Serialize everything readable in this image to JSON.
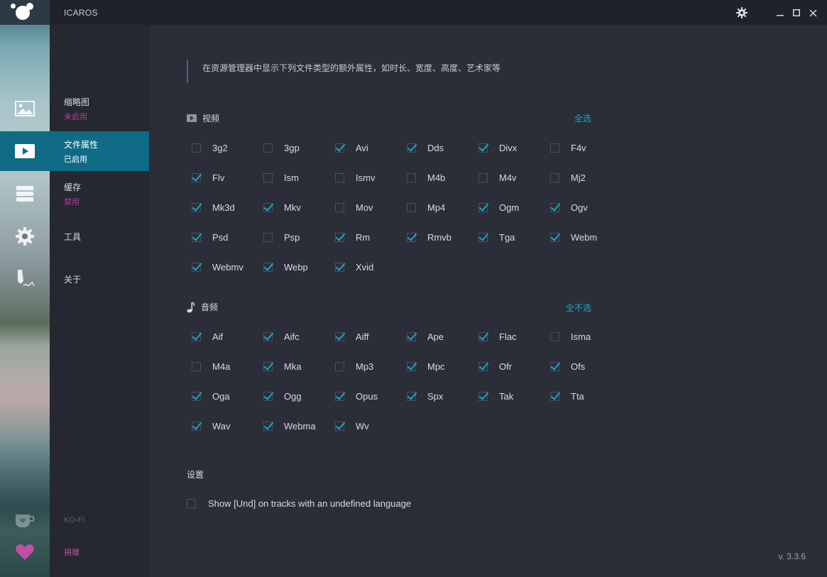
{
  "app": {
    "title": "ICAROS"
  },
  "nav": {
    "items": [
      {
        "label": "缩略图",
        "status": "未启用"
      },
      {
        "label": "文件属性",
        "status": "已启用"
      },
      {
        "label": "缓存",
        "status": "禁用"
      },
      {
        "label": "工具",
        "status": ""
      },
      {
        "label": "关于",
        "status": ""
      }
    ],
    "kofi": "KO-FI",
    "donate": "捐赠"
  },
  "main": {
    "description": "在资源管理器中显示下列文件类型的额外属性，如时长、宽度、高度、艺术家等",
    "video": {
      "heading": "视频",
      "toggle_label": "全选",
      "items": [
        {
          "label": "3g2",
          "checked": false
        },
        {
          "label": "3gp",
          "checked": false
        },
        {
          "label": "Avi",
          "checked": true
        },
        {
          "label": "Dds",
          "checked": true
        },
        {
          "label": "Divx",
          "checked": true
        },
        {
          "label": "F4v",
          "checked": false
        },
        {
          "label": "Flv",
          "checked": true
        },
        {
          "label": "Ism",
          "checked": false
        },
        {
          "label": "Ismv",
          "checked": false
        },
        {
          "label": "M4b",
          "checked": false
        },
        {
          "label": "M4v",
          "checked": false
        },
        {
          "label": "Mj2",
          "checked": false
        },
        {
          "label": "Mk3d",
          "checked": true
        },
        {
          "label": "Mkv",
          "checked": true
        },
        {
          "label": "Mov",
          "checked": false
        },
        {
          "label": "Mp4",
          "checked": false
        },
        {
          "label": "Ogm",
          "checked": true
        },
        {
          "label": "Ogv",
          "checked": true
        },
        {
          "label": "Psd",
          "checked": true
        },
        {
          "label": "Psp",
          "checked": false
        },
        {
          "label": "Rm",
          "checked": true
        },
        {
          "label": "Rmvb",
          "checked": true
        },
        {
          "label": "Tga",
          "checked": true
        },
        {
          "label": "Webm",
          "checked": true
        },
        {
          "label": "Webmv",
          "checked": true
        },
        {
          "label": "Webp",
          "checked": true
        },
        {
          "label": "Xvid",
          "checked": true
        }
      ]
    },
    "audio": {
      "heading": "音频",
      "toggle_label": "全不选",
      "items": [
        {
          "label": "Aif",
          "checked": true
        },
        {
          "label": "Aifc",
          "checked": true
        },
        {
          "label": "Aiff",
          "checked": true
        },
        {
          "label": "Ape",
          "checked": true
        },
        {
          "label": "Flac",
          "checked": true
        },
        {
          "label": "Isma",
          "checked": false
        },
        {
          "label": "M4a",
          "checked": false
        },
        {
          "label": "Mka",
          "checked": true
        },
        {
          "label": "Mp3",
          "checked": false
        },
        {
          "label": "Mpc",
          "checked": true
        },
        {
          "label": "Ofr",
          "checked": true
        },
        {
          "label": "Ofs",
          "checked": true
        },
        {
          "label": "Oga",
          "checked": true
        },
        {
          "label": "Ogg",
          "checked": true
        },
        {
          "label": "Opus",
          "checked": true
        },
        {
          "label": "Spx",
          "checked": true
        },
        {
          "label": "Tak",
          "checked": true
        },
        {
          "label": "Tta",
          "checked": true
        },
        {
          "label": "Wav",
          "checked": true
        },
        {
          "label": "Webma",
          "checked": true
        },
        {
          "label": "Wv",
          "checked": true
        }
      ]
    },
    "settings": {
      "heading": "设置",
      "und_option": {
        "label": "Show [Und] on tracks with an undefined language",
        "checked": false
      }
    },
    "version": "v. 3.3.6"
  },
  "colors": {
    "accent": "#0f6b85",
    "check": "#16a7c9",
    "link": "#1aa5c4",
    "warn": "#b13aa2"
  },
  "icons": [
    "image-icon",
    "play-icon",
    "stack-icon",
    "gear-icon",
    "pen-icon",
    "coffee-cup-icon",
    "heart-icon",
    "settings-gear-icon",
    "minimize-icon",
    "maximize-icon",
    "close-icon",
    "film-icon",
    "music-note-icon"
  ]
}
